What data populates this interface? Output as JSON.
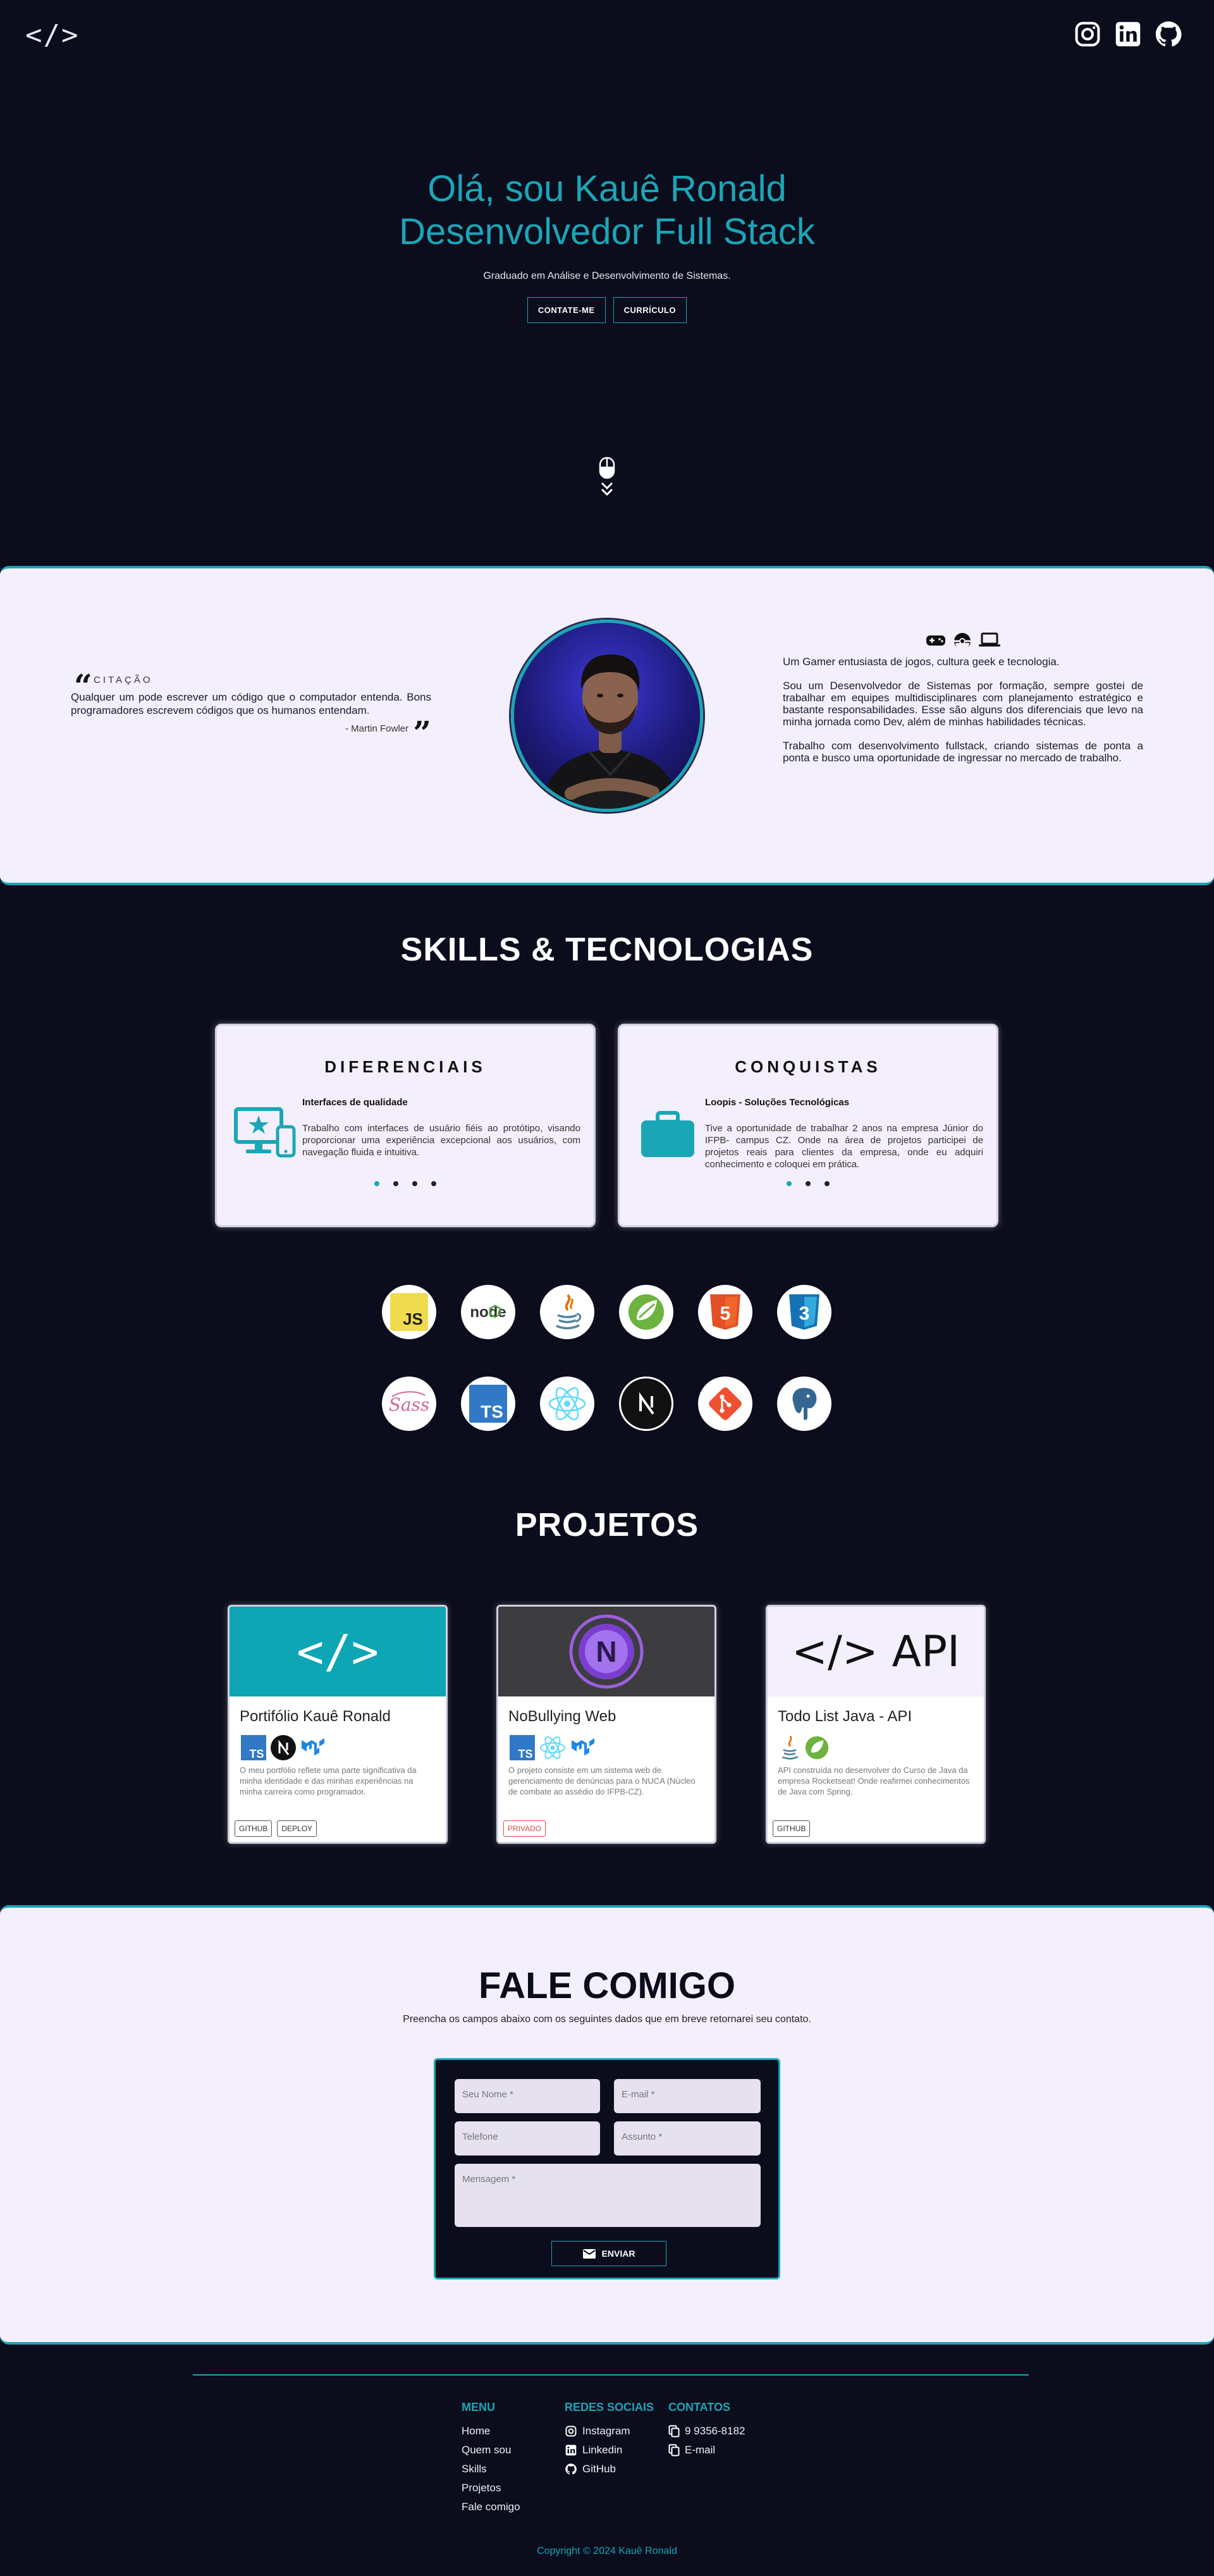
{
  "nav": {
    "logo": "</>",
    "social_icons": [
      "instagram-icon",
      "linkedin-icon",
      "github-icon"
    ]
  },
  "hero": {
    "title_line1": "Olá, sou Kauê Ronald",
    "title_line2": "Desenvolvedor Full Stack",
    "subtitle": "Graduado em Análise e Desenvolvimento de Sistemas.",
    "btn_contact": "CONTATE-ME",
    "btn_resume": "CURRÍCULO"
  },
  "about": {
    "quote_label": "CITAÇÃO",
    "quote_text": "Qualquer um pode escrever um código que o computador entenda. Bons programadores escrevem códigos que os humanos entendam.",
    "quote_author": "- Martin Fowler",
    "p1": "Um Gamer entusiasta de jogos, cultura geek e tecnologia.",
    "p2": "Sou um Desenvolvedor de Sistemas por formação, sempre gostei de trabalhar em equipes multidisciplinares com planejamento estratégico e bastante responsabilidades. Esse são alguns dos diferenciais que levo na minha jornada como Dev, além de minhas habilidades técnicas.",
    "p3": "Trabalho com desenvolvimento fullstack, criando sistemas de ponta a ponta e busco uma oportunidade de ingressar no mercado de trabalho."
  },
  "skills": {
    "title": "SKILLS & TECNOLOGIAS",
    "diferenciais": {
      "title": "DIFERENCIAIS",
      "subtitle": "Interfaces de qualidade",
      "text": "Trabalho com interfaces de usuário fiéis ao protótipo, visando proporcionar uma experiência excepcional aos usuários, com navegação fluida e intuitiva.",
      "dots": 4,
      "active": 0
    },
    "conquistas": {
      "title": "CONQUISTAS",
      "subtitle": "Loopis - Soluções Tecnológicas",
      "text": "Tive a oportunidade de trabalhar 2 anos na empresa Júnior do IFPB- campus CZ. Onde na área de projetos participei de projetos reais para clientes da empresa, onde eu adquiri conhecimento e coloquei em prática.",
      "dots": 3,
      "active": 0
    },
    "techs": [
      "javascript-icon",
      "nodejs-icon",
      "java-icon",
      "spring-icon",
      "html5-icon",
      "css3-icon",
      "sass-icon",
      "typescript-icon",
      "react-icon",
      "nextjs-icon",
      "git-icon",
      "postgresql-icon"
    ]
  },
  "projects": {
    "title": "PROJETOS",
    "items": [
      {
        "title": "Portifólio Kauê Ronald",
        "thumb_text": "</>",
        "desc": "O meu portfólio reflete uma parte significativa da minha identidade e das minhas experiências na minha carreira como programador.",
        "tags": [
          "GITHUB",
          "DEPLOY"
        ]
      },
      {
        "title": "NoBullying Web",
        "thumb_text": "N",
        "desc": "O projeto consiste em um sistema web de gerenciamento de denúncias para o NUCA (Núcleo de combate ao assédio do IFPB-CZ).",
        "tags": [
          "PRIVADO"
        ]
      },
      {
        "title": "Todo List Java - API",
        "thumb_text": "</> API",
        "desc": "API construída no desenvolver do Curso de Java da empresa Rocketseat! Onde reafirmei conhecimentos de Java com Spring.",
        "tags": [
          "GITHUB"
        ]
      }
    ]
  },
  "contact": {
    "title": "FALE COMIGO",
    "desc": "Preencha os campos abaixo com os seguintes dados que em breve retornarei seu contato.",
    "name_ph": "Seu Nome *",
    "email_ph": "E-mail *",
    "phone_ph": "Telefone",
    "subject_ph": "Assunto *",
    "message_ph": "Mensagem *",
    "send": "ENVIAR"
  },
  "footer": {
    "menu_title": "MENU",
    "menu": [
      "Home",
      "Quem sou",
      "Skills",
      "Projetos",
      "Fale comigo"
    ],
    "social_title": "REDES SOCIAIS",
    "social": [
      "Instagram",
      "Linkedin",
      "GitHub"
    ],
    "contacts_title": "CONTATOS",
    "contacts": [
      "9 9356-8182",
      "E-mail"
    ],
    "copyright": "Copyright © 2024 Kauê Ronald"
  },
  "colors": {
    "accent": "#1aa6b7",
    "bg": "#0b0c1c",
    "panel": "#f4effc"
  }
}
